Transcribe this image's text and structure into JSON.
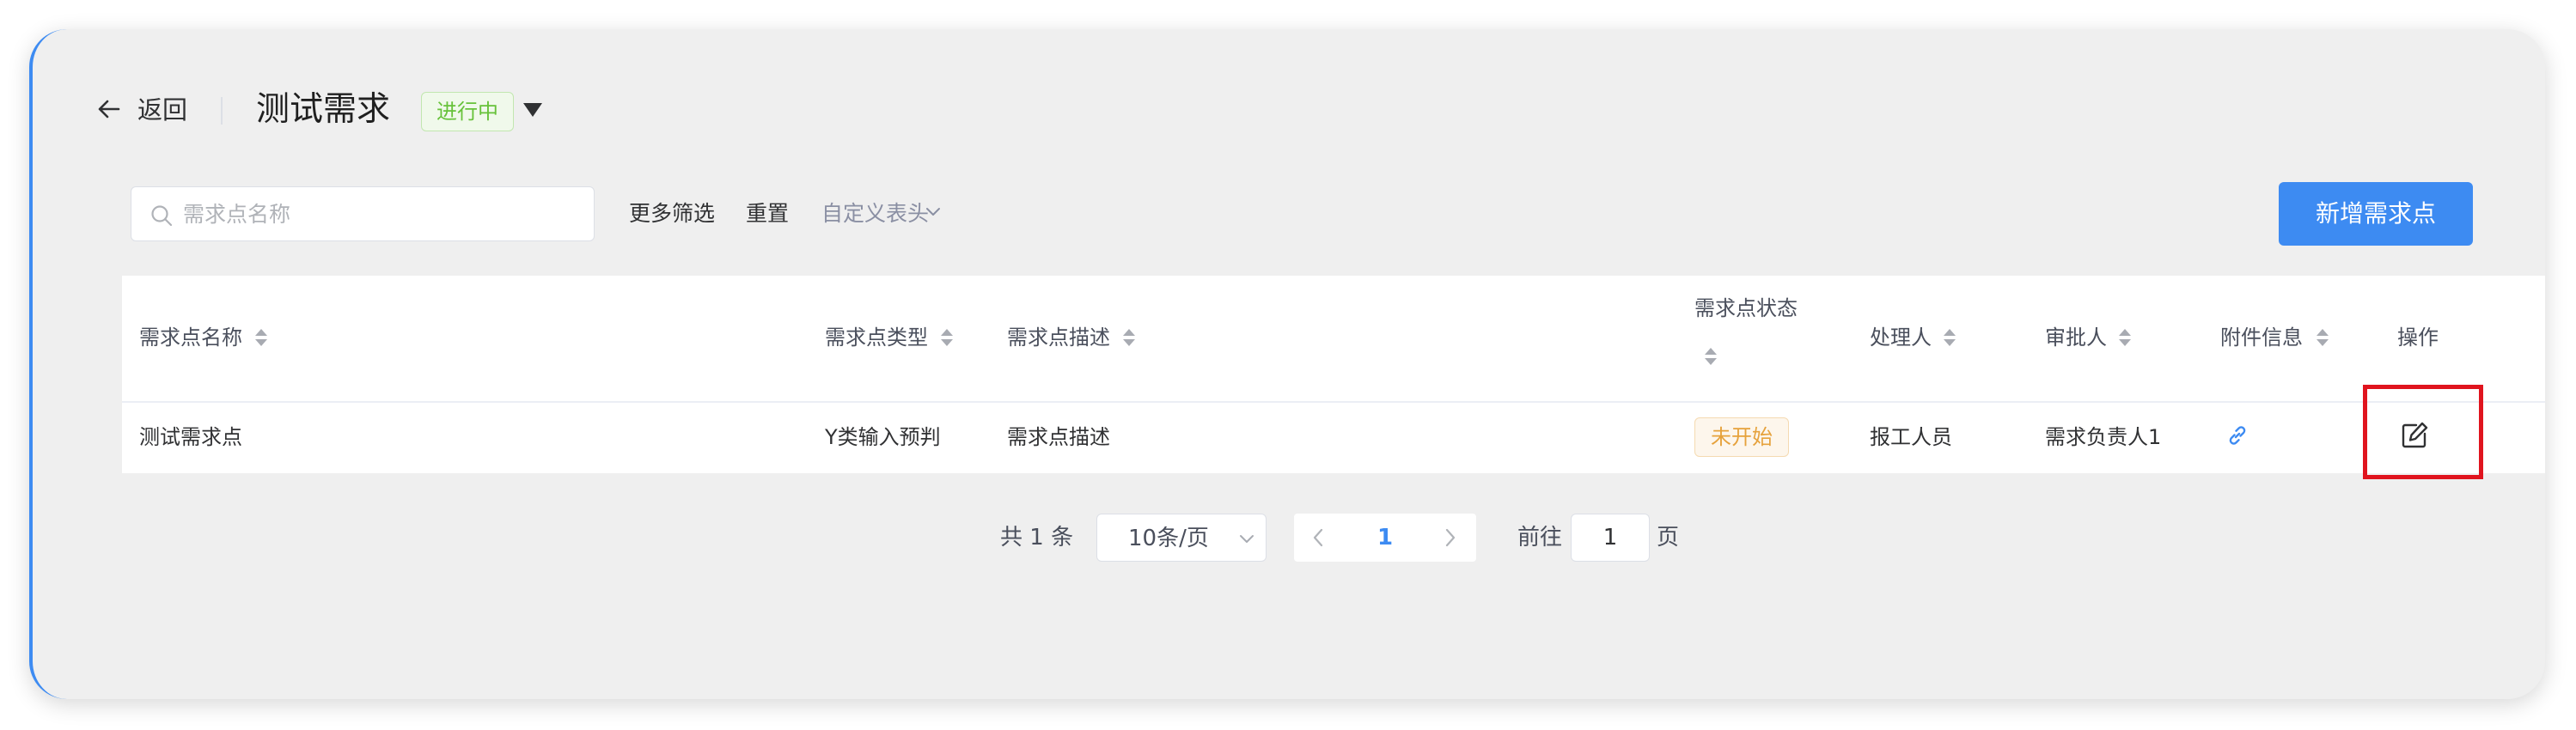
{
  "header": {
    "back_label": "返回",
    "title": "测试需求",
    "status": "进行中"
  },
  "filters": {
    "search_placeholder": "需求点名称",
    "more_filters": "更多筛选",
    "reset": "重置",
    "custom_columns": "自定义表头",
    "add_button": "新增需求点"
  },
  "table": {
    "columns": [
      "需求点名称",
      "需求点类型",
      "需求点描述",
      "需求点状态",
      "处理人",
      "审批人",
      "附件信息",
      "操作"
    ],
    "rows": [
      {
        "name": "测试需求点",
        "type": "Y类输入预判",
        "description": "需求点描述",
        "status": "未开始",
        "handler": "报工人员",
        "approver": "需求负责人1",
        "attachment_icon": "link-icon",
        "action_icon": "edit-icon"
      }
    ]
  },
  "pagination": {
    "total": "共 1 条",
    "page_size": "10条/页",
    "current_page": "1",
    "goto_label": "前往",
    "goto_value": "1",
    "page_suffix": "页"
  },
  "colors": {
    "primary": "#3d8bf2",
    "status_in_progress": "#67c23a",
    "status_not_started": "#e6a23c",
    "highlight": "#e0141e"
  },
  "icons": [
    "arrow-left-icon",
    "caret-down-icon",
    "search-icon",
    "chevron-down-icon",
    "sort-icon",
    "link-icon",
    "edit-icon",
    "chevron-left-icon",
    "chevron-right-icon"
  ]
}
